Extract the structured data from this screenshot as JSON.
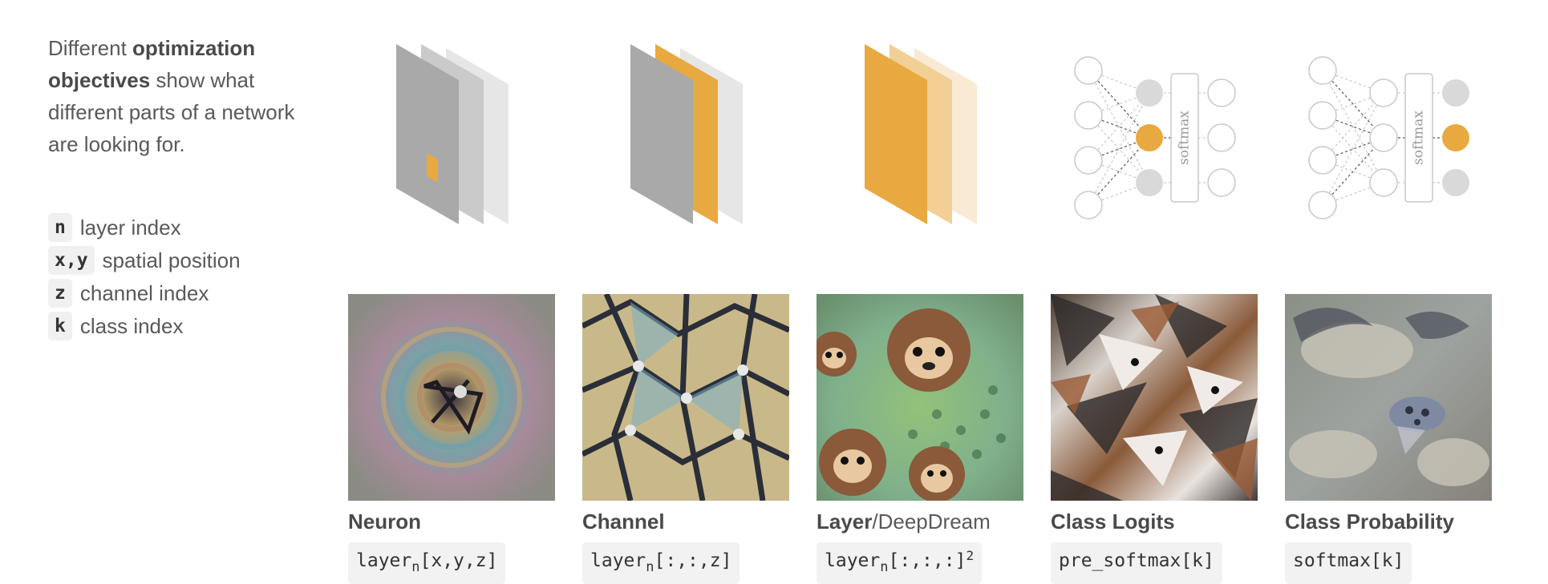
{
  "intro": {
    "pre": "Different ",
    "bold": "optimization objectives",
    "post": " show what different parts of a network are looking for."
  },
  "legend": [
    {
      "key": "n",
      "label": "layer index"
    },
    {
      "key": "x,y",
      "label": "spatial position"
    },
    {
      "key": "z",
      "label": "channel index"
    },
    {
      "key": "k",
      "label": "class index"
    }
  ],
  "colors": {
    "accent": "#e8a940",
    "gray": "#a9a9a9",
    "light_gray": "#d9d9d9"
  },
  "columns": [
    {
      "title_bold": "Neuron",
      "title_rest": "",
      "formula": {
        "base": "layer",
        "sub": "n",
        "rest": "[x,y,z]",
        "sup": ""
      },
      "icon": "neuron-layer-stack-icon",
      "image": "neuron-visualization-image"
    },
    {
      "title_bold": "Channel",
      "title_rest": "",
      "formula": {
        "base": "layer",
        "sub": "n",
        "rest": "[:,:,z]",
        "sup": ""
      },
      "icon": "channel-layer-stack-icon",
      "image": "channel-visualization-image"
    },
    {
      "title_bold": "Layer",
      "title_rest": "/DeepDream",
      "formula": {
        "base": "layer",
        "sub": "n",
        "rest": "[:,:,:]",
        "sup": "2"
      },
      "icon": "layer-stack-icon",
      "image": "deepdream-visualization-image"
    },
    {
      "title_bold": "Class Logits",
      "title_rest": "",
      "formula": {
        "base": "pre_softmax[k]",
        "sub": "",
        "rest": "",
        "sup": ""
      },
      "icon": "logits-network-icon",
      "image": "class-logits-visualization-image",
      "softmax_label": "softmax"
    },
    {
      "title_bold": "Class Probability",
      "title_rest": "",
      "formula": {
        "base": "softmax[k]",
        "sub": "",
        "rest": "",
        "sup": ""
      },
      "icon": "probability-network-icon",
      "image": "class-probability-visualization-image",
      "softmax_label": "softmax"
    }
  ]
}
